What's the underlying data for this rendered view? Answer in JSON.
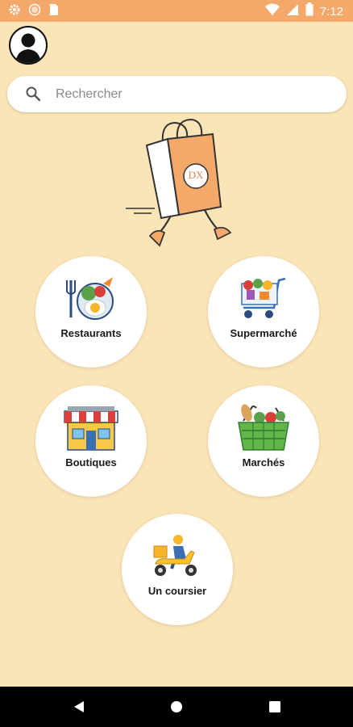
{
  "status_bar": {
    "time": "7:12",
    "background": "#f4a96b",
    "left_icons": [
      "settings-icon",
      "circle-icon",
      "sim-card-icon"
    ],
    "right_icons": [
      "wifi-icon",
      "signal-icon",
      "battery-icon"
    ]
  },
  "header": {
    "avatar_icon": "user-silhouette-icon"
  },
  "search": {
    "placeholder": "Rechercher",
    "value": ""
  },
  "brand": {
    "bag_text": "DX",
    "mascot_icon": "running-shopping-bag-icon"
  },
  "categories": [
    {
      "label": "Restaurants",
      "icon": "food-plate-icon"
    },
    {
      "label": "Supermarché",
      "icon": "shopping-cart-icon"
    },
    {
      "label": "Boutiques",
      "icon": "storefront-icon"
    },
    {
      "label": "Marchés",
      "icon": "market-basket-icon"
    },
    {
      "label": "Un coursier",
      "icon": "delivery-scooter-icon"
    }
  ],
  "colors": {
    "page_background": "#fbe4b6",
    "accent": "#f4a96b",
    "tile_background": "#ffffff"
  },
  "nav_bar": {
    "buttons": [
      "back-icon",
      "home-icon",
      "recents-icon"
    ]
  }
}
